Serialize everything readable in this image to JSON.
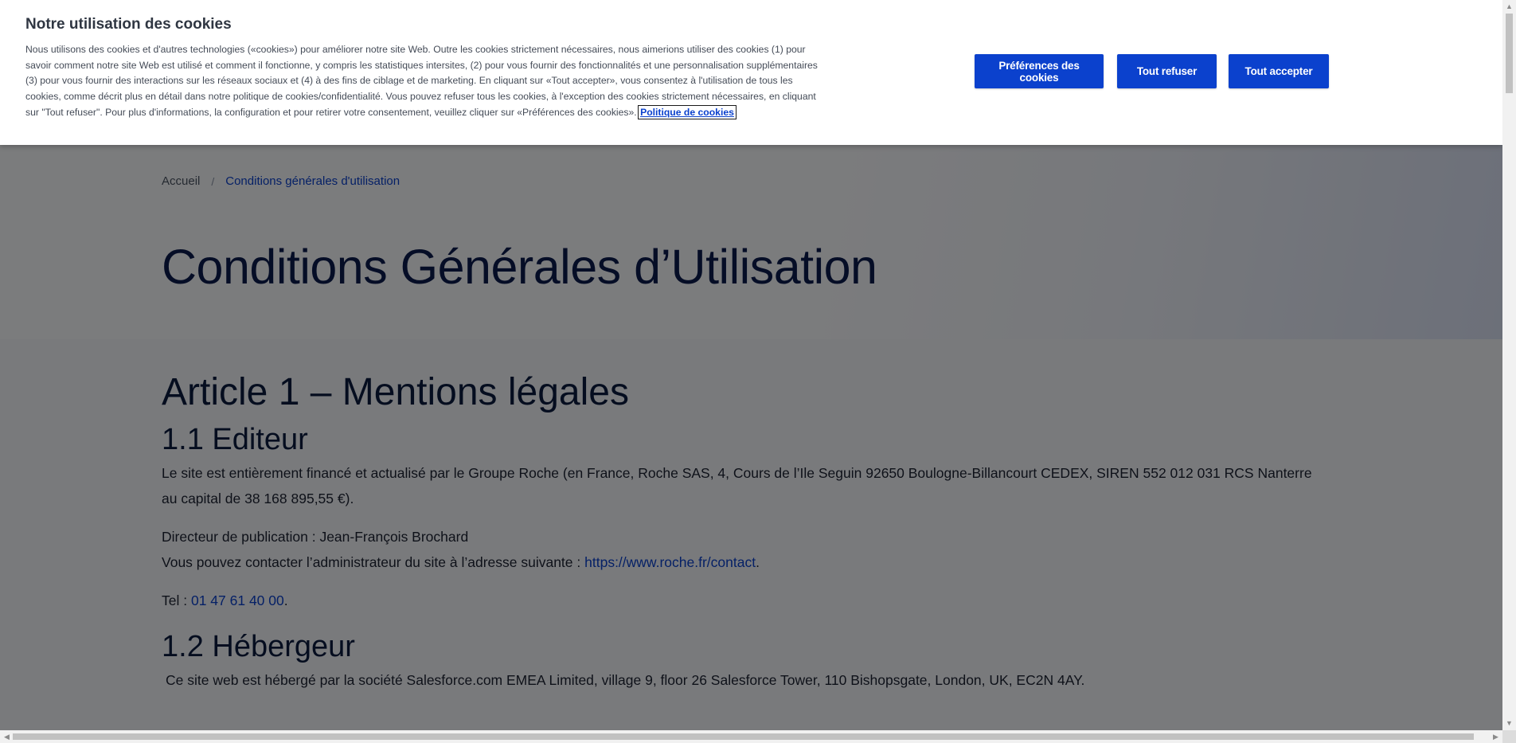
{
  "cookie_banner": {
    "title": "Notre utilisation des cookies",
    "text": "Nous utilisons des cookies et d'autres technologies («cookies») pour améliorer notre site Web. Outre les cookies strictement nécessaires, nous aimerions utiliser des cookies (1) pour savoir comment notre site Web est utilisé et comment il fonctionne, y compris les statistiques intersites, (2) pour vous fournir des fonctionnalités et une personnalisation supplémentaires (3) pour vous fournir des interactions sur les réseaux sociaux et (4) à des fins de ciblage et de marketing. En cliquant sur «Tout accepter», vous consentez à l'utilisation de tous les cookies, comme décrit plus en détail dans notre politique de cookies/confidentialité. Vous pouvez refuser tous les cookies, à l'exception des cookies strictement nécessaires, en cliquant sur \"Tout refuser\". Pour plus d'informations, la configuration et pour retirer votre consentement, veuillez cliquer sur «Préférences des cookies».",
    "policy_link": "Politique de cookies",
    "btn_preferences": "Préférences des cookies",
    "btn_refuse": "Tout refuser",
    "btn_accept": "Tout accepter",
    "accent_color": "#0b41cd"
  },
  "breadcrumb": {
    "home": "Accueil",
    "separator": "/",
    "current": "Conditions générales d'utilisation"
  },
  "page_title": "Conditions Générales d’Utilisation",
  "article": {
    "heading": "Article 1 – Mentions légales",
    "s1_heading": "1.1 Editeur",
    "s1_p1": "Le site est entièrement financé et actualisé par le Groupe Roche (en France, Roche SAS, 4, Cours de l’Ile Seguin 92650 Boulogne-Billancourt CEDEX, SIREN 552 012 031 RCS Nanterre au capital de 38 168 895,55 €).",
    "s1_director": "Directeur de publication : Jean-François Brochard",
    "s1_contact_prefix": "Vous pouvez contacter l’administrateur du site à l’adresse suivante : ",
    "s1_contact_link": "https://www.roche.fr/contact",
    "s1_contact_suffix": ".",
    "s1_tel_prefix": "Tel : ",
    "s1_tel_link": "01 47 61 40 00",
    "s1_tel_suffix": ".",
    "s2_heading": "1.2 Hébergeur",
    "s2_p1": "Ce site web est hébergé par la société Salesforce.com EMEA Limited, village 9, floor 26 Salesforce Tower, 110 Bishopsgate, London, UK, EC2N 4AY."
  },
  "scrollbar_icons": {
    "up": "arrow-up-icon",
    "down": "arrow-down-icon",
    "left": "arrow-left-icon",
    "right": "arrow-right-icon"
  }
}
